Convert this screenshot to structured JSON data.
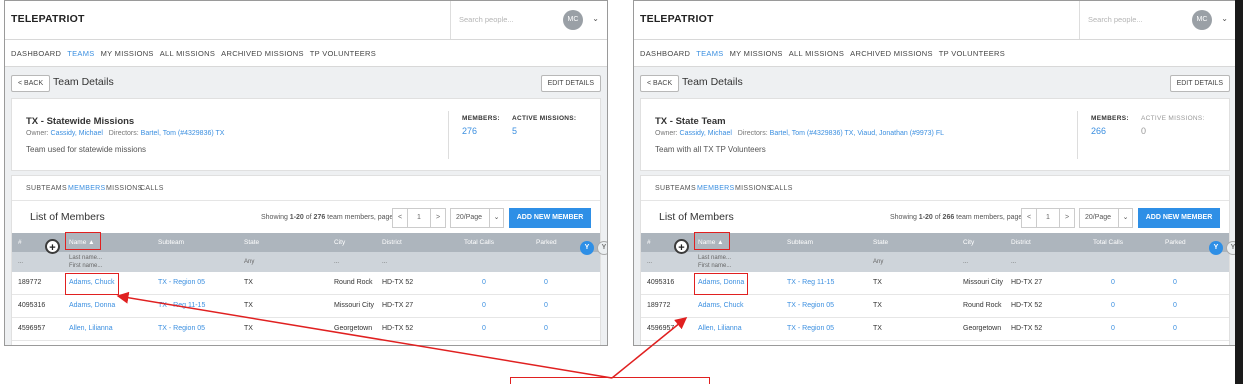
{
  "app": {
    "logo": "TELEPATRIOT",
    "search_placeholder": "Search people...",
    "avatar_initials": "MC",
    "nav": [
      "DASHBOARD",
      "TEAMS",
      "MY MISSIONS",
      "ALL MISSIONS",
      "ARCHIVED MISSIONS",
      "TP VOLUNTEERS"
    ],
    "active_nav": "TEAMS",
    "back_label": "BACK",
    "page_title": "Team Details",
    "edit_label": "EDIT DETAILS",
    "tabs": [
      "SUBTEAMS",
      "MEMBERS",
      "MISSIONS",
      "CALLS"
    ],
    "list_title": "List of Members",
    "per_page": "20/Page",
    "add_member_label": "ADD NEW MEMBER",
    "members_label": "MEMBERS:",
    "active_missions_label": "ACTIVE MISSIONS:",
    "columns": [
      "#",
      "Name ▲",
      "Subteam",
      "State",
      "City",
      "District",
      "Total Calls",
      "Parked"
    ],
    "filter": {
      "last_name": "Last name...",
      "first_name": "First name...",
      "state": "Any",
      "ellipsis": "..."
    },
    "page": "1",
    "owner_label": "Owner:",
    "directors_label": "Directors:"
  },
  "screens": [
    {
      "team_name": "TX - Statewide Missions",
      "owner": "Cassidy, Michael",
      "directors": "Bartel, Tom (#4329836) TX",
      "description": "Team used for statewide missions",
      "members": "276",
      "active_missions": "5",
      "showing_prefix": "Showing ",
      "showing_range": "1-20",
      "showing_of": " of ",
      "showing_total": "276",
      "showing_suffix": " team members, page",
      "rows": [
        {
          "id": "189772",
          "name": "Adams, Chuck",
          "subteam": "TX - Region 05",
          "state": "TX",
          "city": "Round Rock",
          "district": "HD-TX 52",
          "calls": "0",
          "parked": "0"
        },
        {
          "id": "4095316",
          "name": "Adams, Donna",
          "subteam": "TX - Reg 11-15",
          "state": "TX",
          "city": "Missouri City",
          "district": "HD-TX 27",
          "calls": "0",
          "parked": "0"
        },
        {
          "id": "4596957",
          "name": "Allen, Lilianna",
          "subteam": "TX - Region 05",
          "state": "TX",
          "city": "Georgetown",
          "district": "HD-TX 52",
          "calls": "0",
          "parked": "0"
        }
      ]
    },
    {
      "team_name": "TX - State Team",
      "owner": "Cassidy, Michael",
      "directors": "Bartel, Tom (#4329836) TX,  Viaud, Jonathan (#9973) FL",
      "description": "Team with all TX TP Volunteers",
      "members": "266",
      "active_missions": "0",
      "showing_prefix": "Showing ",
      "showing_range": "1-20",
      "showing_of": " of ",
      "showing_total": "266",
      "showing_suffix": " team members, page",
      "rows": [
        {
          "id": "4095316",
          "name": "Adams, Donna",
          "subteam": "TX - Reg 11-15",
          "state": "TX",
          "city": "Missouri City",
          "district": "HD-TX 27",
          "calls": "0",
          "parked": "0"
        },
        {
          "id": "189772",
          "name": "Adams, Chuck",
          "subteam": "TX - Region 05",
          "state": "TX",
          "city": "Round Rock",
          "district": "HD-TX 52",
          "calls": "0",
          "parked": "0"
        },
        {
          "id": "4596957",
          "name": "Allen, Lilianna",
          "subteam": "TX - Region 05",
          "state": "TX",
          "city": "Georgetown",
          "district": "HD-TX 52",
          "calls": "0",
          "parked": "0"
        }
      ]
    }
  ],
  "colors": {
    "accent": "#2e8fe6",
    "link": "#3b8fe0",
    "highlight": "#e02020",
    "header": "#adb5bd"
  }
}
